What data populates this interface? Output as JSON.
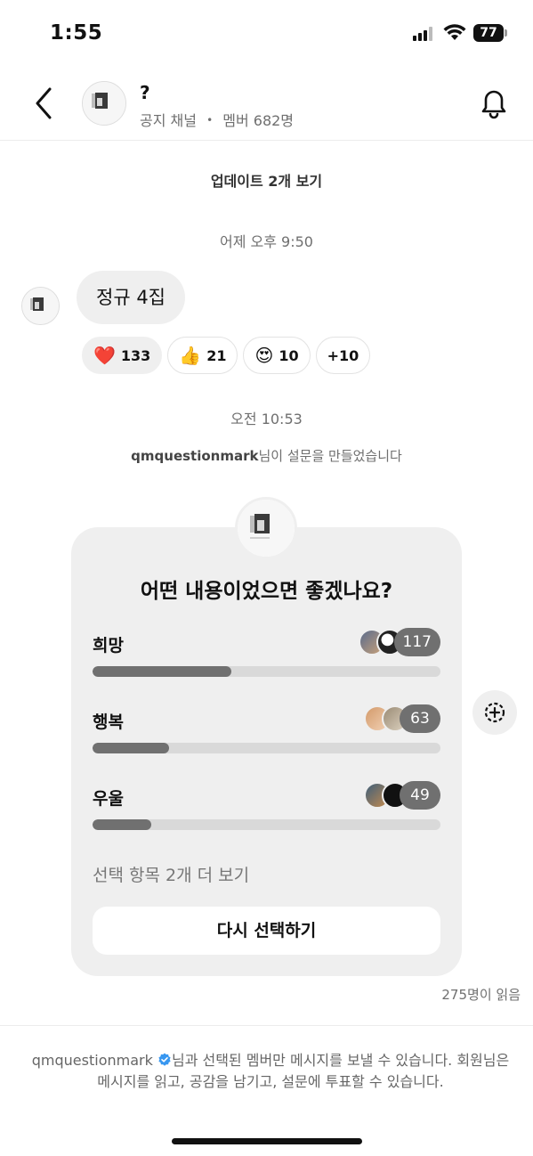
{
  "status_bar": {
    "time": "1:55",
    "battery": "77"
  },
  "header": {
    "title": "?",
    "subtitle_type": "공지 채널",
    "subtitle_sep": "•",
    "subtitle_members": "멤버 682명"
  },
  "updates_link": "업데이트 2개 보기",
  "message": {
    "timestamp": "어제 오후 9:50",
    "text": "정규 4집",
    "reactions": [
      {
        "emoji": "❤️",
        "count": "133",
        "selected": true
      },
      {
        "emoji": "👍",
        "count": "21"
      },
      {
        "emoji": "😍",
        "count": "10"
      },
      {
        "emoji": "",
        "count": "+10"
      }
    ]
  },
  "poll_event": {
    "timestamp": "오전 10:53",
    "creator": "qmquestionmark",
    "notice": "님이 설문을 만들었습니다"
  },
  "poll": {
    "question": "어떤 내용이었으면 좋겠나요?",
    "options": [
      {
        "label": "희망",
        "count": "117",
        "fraction": 0.4
      },
      {
        "label": "행복",
        "count": "63",
        "fraction": 0.22
      },
      {
        "label": "우울",
        "count": "49",
        "fraction": 0.17
      }
    ],
    "more_options": "선택 항목 2개 더 보기",
    "revote_label": "다시 선택하기"
  },
  "read_count": "275명이 읽음",
  "footer": {
    "name": "qmquestionmark",
    "text_1": "님과 선택된 멤버만 메시지를 보낼 수 있습니다. 회원님은 메시지를 읽고, 공감을 남기고, 설문에 투표할 수 있습니다."
  },
  "icons": {
    "back": "chevron-left-icon",
    "bell": "bell-icon",
    "add_reaction": "add-reaction-icon",
    "verified": "verified-badge-icon"
  },
  "colors": {
    "verified": "#3897f0",
    "poll_fill": "#707070",
    "heart": "#e0245e"
  }
}
